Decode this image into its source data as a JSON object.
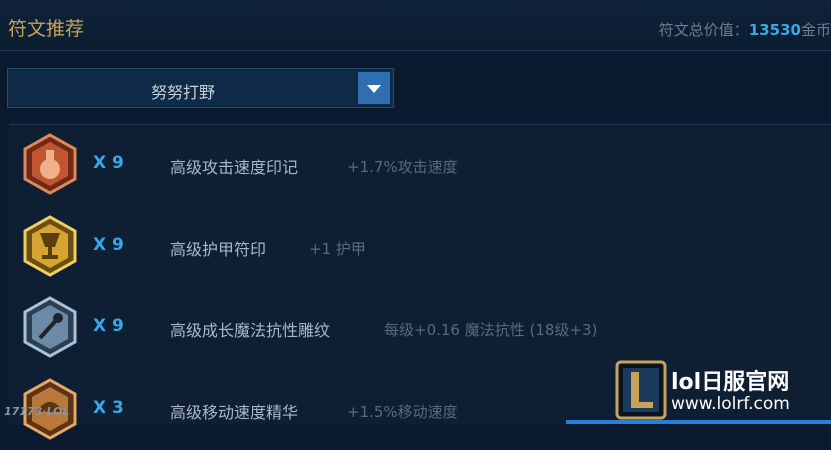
{
  "header": {
    "title": "符文推荐",
    "total_label": "符文总价值：",
    "total_value": "13530",
    "total_unit": "金币"
  },
  "selector": {
    "selected": "努努打野"
  },
  "runes": [
    {
      "count": "X 9",
      "name": "高级攻击速度印记",
      "desc": "+1.7%攻击速度",
      "icon": "red-potion-mark-icon",
      "color": "#c0552f"
    },
    {
      "count": "X 9",
      "name": "高级护甲符印",
      "desc": "+1 护甲",
      "icon": "gold-chalice-seal-icon",
      "color": "#d6a531"
    },
    {
      "count": "X 9",
      "name": "高级成长魔法抗性雕纹",
      "desc": "每级+0.16 魔法抗性 (18级+3)",
      "icon": "blue-glyph-icon",
      "color": "#6c8aa6"
    },
    {
      "count": "X 3",
      "name": "高级移动速度精华",
      "desc": "+1.5%移动速度",
      "icon": "bronze-quintessence-icon",
      "color": "#b8783c"
    }
  ],
  "watermark": {
    "text": "17173·LOL"
  },
  "brand": {
    "name": "lol日服官网",
    "url": "www.lolrf.com",
    "logo": "league-logo-icon"
  }
}
